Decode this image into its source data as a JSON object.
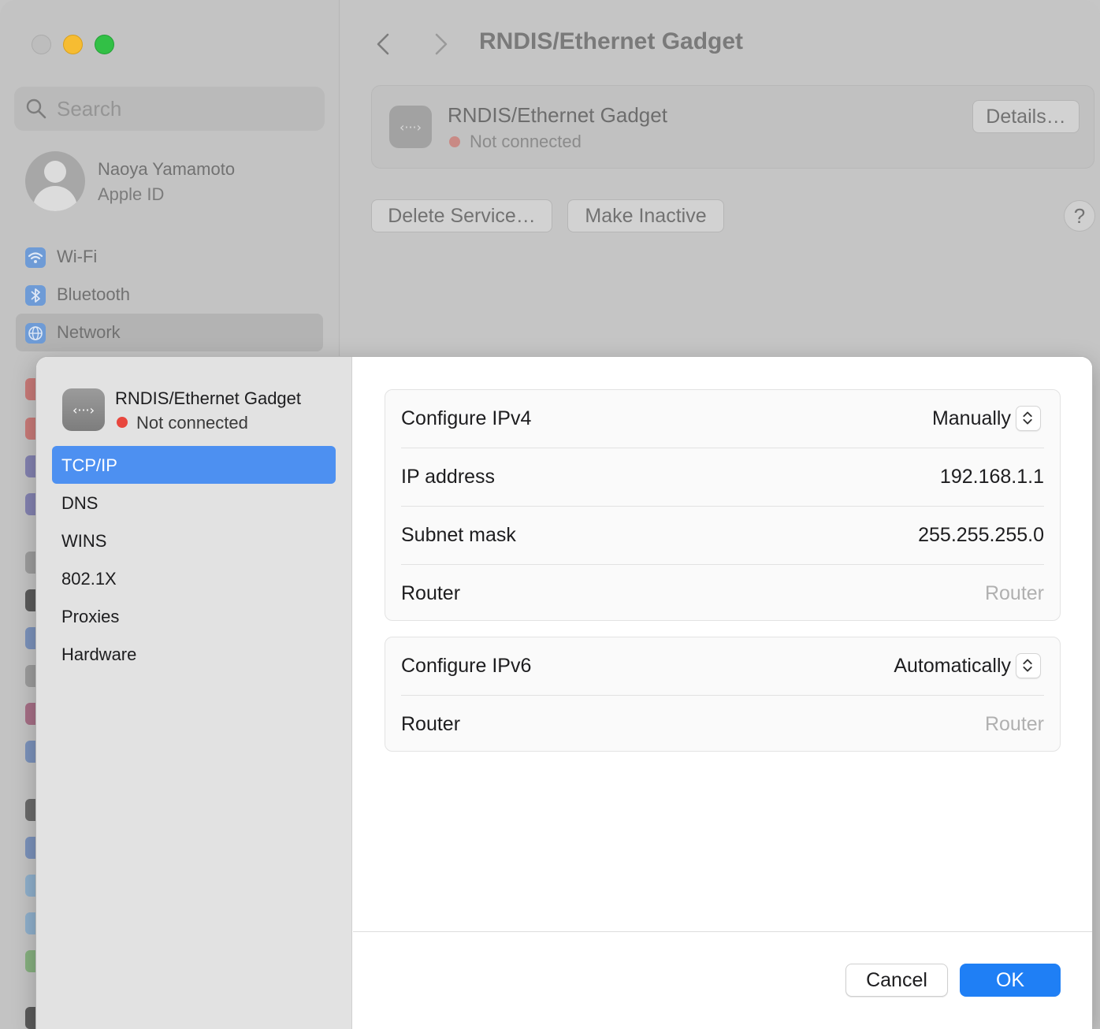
{
  "window": {
    "title": "RNDIS/Ethernet Gadget"
  },
  "sidebar": {
    "search_placeholder": "Search",
    "user": {
      "name": "Naoya Yamamoto",
      "subtitle": "Apple ID"
    },
    "items": [
      {
        "label": "Wi-Fi",
        "icon": "wifi-icon",
        "color": "#4a8fe6"
      },
      {
        "label": "Bluetooth",
        "icon": "bluetooth-icon",
        "color": "#4a8fe6"
      },
      {
        "label": "Network",
        "icon": "globe-icon",
        "color": "#4a8fe6",
        "selected": true
      }
    ]
  },
  "service": {
    "name": "RNDIS/Ethernet Gadget",
    "status": "Not connected",
    "status_color": "#e8473e",
    "details_label": "Details…",
    "delete_label": "Delete Service…",
    "inactive_label": "Make Inactive",
    "help_label": "?"
  },
  "sheet": {
    "service_name": "RNDIS/Ethernet Gadget",
    "service_status": "Not connected",
    "nav": [
      {
        "label": "TCP/IP",
        "selected": true
      },
      {
        "label": "DNS"
      },
      {
        "label": "WINS"
      },
      {
        "label": "802.1X"
      },
      {
        "label": "Proxies"
      },
      {
        "label": "Hardware"
      }
    ],
    "ipv4": {
      "configure_label": "Configure IPv4",
      "configure_value": "Manually",
      "ip_label": "IP address",
      "ip_value": "192.168.1.1",
      "subnet_label": "Subnet mask",
      "subnet_value": "255.255.255.0",
      "router_label": "Router",
      "router_placeholder": "Router"
    },
    "ipv6": {
      "configure_label": "Configure IPv6",
      "configure_value": "Automatically",
      "router_label": "Router",
      "router_placeholder": "Router"
    },
    "cancel_label": "Cancel",
    "ok_label": "OK",
    "accent_color": "#1f7ff5"
  }
}
